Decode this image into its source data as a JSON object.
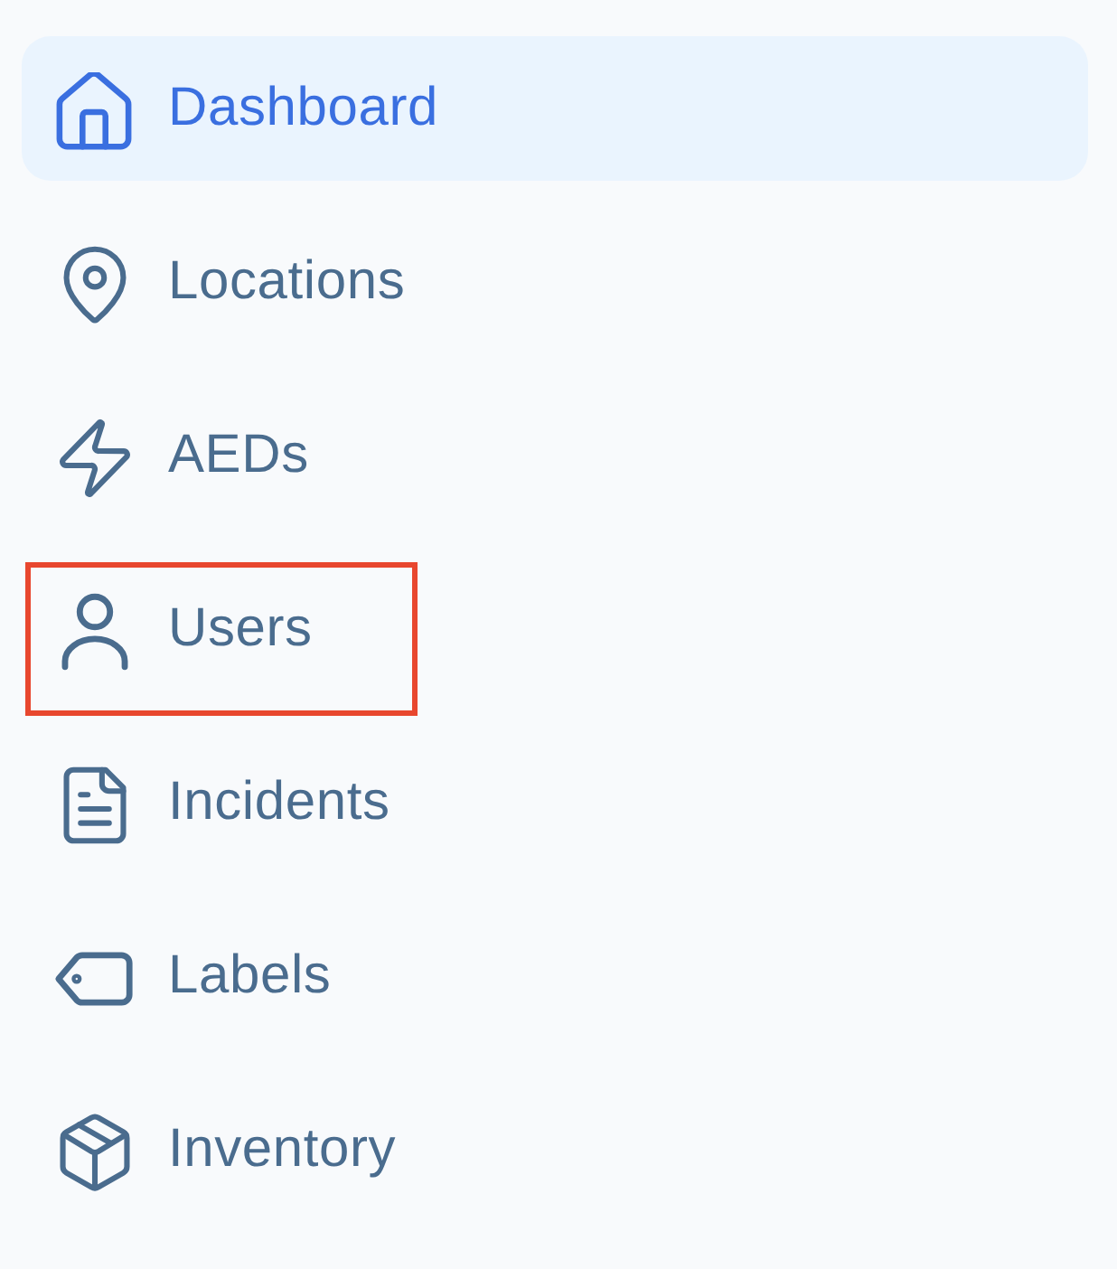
{
  "sidebar": {
    "items": [
      {
        "label": "Dashboard",
        "selected": true,
        "highlighted": false
      },
      {
        "label": "Locations",
        "selected": false,
        "highlighted": false
      },
      {
        "label": "AEDs",
        "selected": false,
        "highlighted": false
      },
      {
        "label": "Users",
        "selected": false,
        "highlighted": true
      },
      {
        "label": "Incidents",
        "selected": false,
        "highlighted": false
      },
      {
        "label": "Labels",
        "selected": false,
        "highlighted": false
      },
      {
        "label": "Inventory",
        "selected": false,
        "highlighted": false
      }
    ]
  }
}
